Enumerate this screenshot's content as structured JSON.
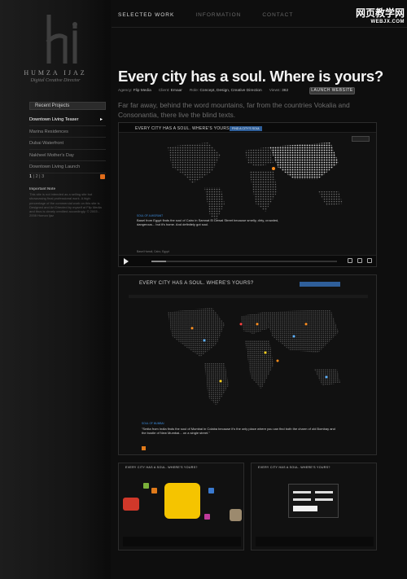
{
  "watermark": {
    "line1": "网页教学网",
    "line2": "WEBJX.COM"
  },
  "brand": {
    "name": "HUMZA IJAZ",
    "tagline": "Digital Creative Director"
  },
  "nav": [
    {
      "label": "SELECTED WORK"
    },
    {
      "label": "INFORMATION"
    },
    {
      "label": "CONTACT"
    }
  ],
  "sidebar": {
    "recent_label": "Recent Projects",
    "projects": [
      {
        "label": "Downtown Living Teaser",
        "arrow": "▸"
      },
      {
        "label": "Marina Residences"
      },
      {
        "label": "Dubai Waterfront"
      },
      {
        "label": "Nakheel Mother's Day"
      },
      {
        "label": "Downtown Living Launch"
      }
    ],
    "pager": {
      "current": "1",
      "others": [
        "2",
        "3"
      ]
    },
    "note_title": "Important Note",
    "note_body": "This site is not intended as a selling site but showcasing final professional work. A high percentage of the commercial work on this site is Designed and Art Directed by myself at Flip Media and thus is clearly credited accordingly. © 2003 - 2008 Humza Ijaz"
  },
  "project": {
    "headline": "Every city has a soul. Where is yours?",
    "meta": [
      {
        "label": "Agency:",
        "value": "Flip Media"
      },
      {
        "label": "Client:",
        "value": "Emaar"
      },
      {
        "label": "Role:",
        "value": "Concept, Design, Creative Direction"
      },
      {
        "label": "Views:",
        "value": "362"
      }
    ],
    "launch_label": "LAUNCH WEBSITE",
    "intro": "Far far away, behind the word mountains, far from the countries Vokalia and Consonantia, there live the blind texts."
  },
  "shot1": {
    "title": "EVERY CITY HAS A SOUL. WHERE'S YOURS?",
    "badge": "FIND A CITY'S SOUL",
    "caption_tag": "SOUL OF A MIGRANT",
    "caption": "Basel from Egypt finds the soul of Cairo in Samnat El Dewal Street because smelly, dirty, crowded, dangerous... but it's home. And definitely got soul.",
    "author": "Basel Hamdi, Cairo, Egypt"
  },
  "shot2": {
    "title": "EVERY CITY HAS A SOUL. WHERE'S YOURS?",
    "caption_tag": "SOUL OF MUMBAI",
    "caption": "\"Smita from India finds the soul of Mumbai in Colaba because it's the only place where you can find both the charm of old Bombay and the bustle of New Mumbai... on a single street.\""
  },
  "shot3": {
    "title": "EVERY CITY HAS A SOUL. WHERE'S YOURS?"
  },
  "shot4": {
    "title": "EVERY CITY HAS A SOUL. WHERE'S YOURS?"
  },
  "colors": {
    "accent": "#2f5f9a",
    "rss": "#e06c1a",
    "bubble": "#f5c400",
    "bg": "#0e0e0e"
  }
}
